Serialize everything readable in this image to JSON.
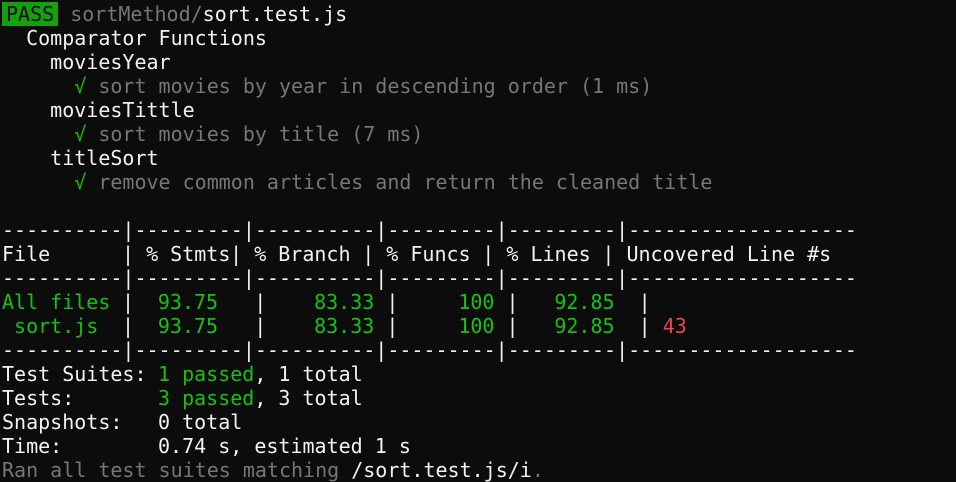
{
  "header": {
    "status": "PASS",
    "dir": "sortMethod/",
    "file": "sort.test.js"
  },
  "suite": {
    "name": "Comparator Functions",
    "groups": [
      {
        "name": "moviesYear",
        "tests": [
          {
            "check": "√",
            "text": "sort movies by year in descending order (1 ms)"
          }
        ]
      },
      {
        "name": "moviesTittle",
        "tests": [
          {
            "check": "√",
            "text": "sort movies by title (7 ms)"
          }
        ]
      },
      {
        "name": "titleSort",
        "tests": [
          {
            "check": "√",
            "text": "remove common articles and return the cleaned title"
          }
        ]
      }
    ]
  },
  "coverage": {
    "separator": "----------|---------|----------|---------|---------|-------------------",
    "headers": [
      "File",
      "% Stmts",
      "% Branch",
      "% Funcs",
      "% Lines",
      "Uncovered Line #s"
    ],
    "rows": [
      {
        "file": "All files",
        "stmts": "93.75",
        "branch": "83.33",
        "funcs": "100",
        "lines": "92.85",
        "uncovered": ""
      },
      {
        "file": "sort.js",
        "stmts": "93.75",
        "branch": "83.33",
        "funcs": "100",
        "lines": "92.85",
        "uncovered": "43"
      }
    ]
  },
  "summary": {
    "test_suites": {
      "label": "Test Suites:",
      "passed": "1 passed",
      "rest": ", 1 total"
    },
    "tests": {
      "label": "Tests:",
      "passed": "3 passed",
      "rest": ", 3 total"
    },
    "snapshots": {
      "label": "Snapshots:",
      "value": "0 total"
    },
    "time": {
      "label": "Time:",
      "value": "0.74 s, estimated 1 s"
    },
    "ran": {
      "prefix": "Ran all test suites matching ",
      "pattern": "/sort.test.js/i",
      "suffix": "."
    }
  },
  "colors": {
    "background": "#0c0c0c",
    "pass_badge": "#13a10e",
    "green": "#13c40e",
    "red": "#e74856",
    "gray": "#767676",
    "white": "#f2f2f2"
  }
}
